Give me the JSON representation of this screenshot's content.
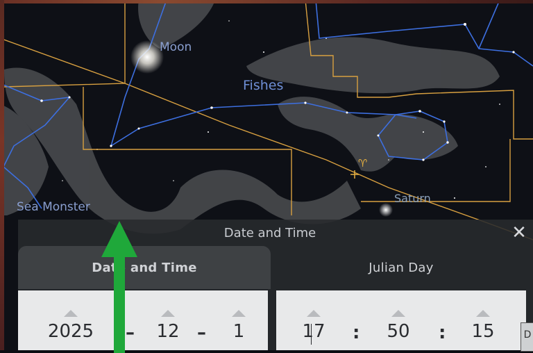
{
  "sky": {
    "labels": {
      "moon": "Moon",
      "fishes": "Fishes",
      "sea_monster": "Sea Monster",
      "saturn": "Saturn",
      "aries_symbol": "♈"
    }
  },
  "dialog": {
    "title": "Date and Time",
    "close_glyph": "✕",
    "tabs": [
      {
        "label": "Date and Time"
      },
      {
        "label": "Julian Day"
      }
    ],
    "date": {
      "year": "2025",
      "month": "12",
      "day": "1",
      "separator": "–"
    },
    "time": {
      "hour": "17",
      "minute": "50",
      "second": "15",
      "separator": ":"
    },
    "edge_chip_text": "D"
  },
  "colors": {
    "constellation_lines": "#3d6fe0",
    "boundaries": "#d8a040",
    "pointer_arrow": "#1fa83a"
  }
}
